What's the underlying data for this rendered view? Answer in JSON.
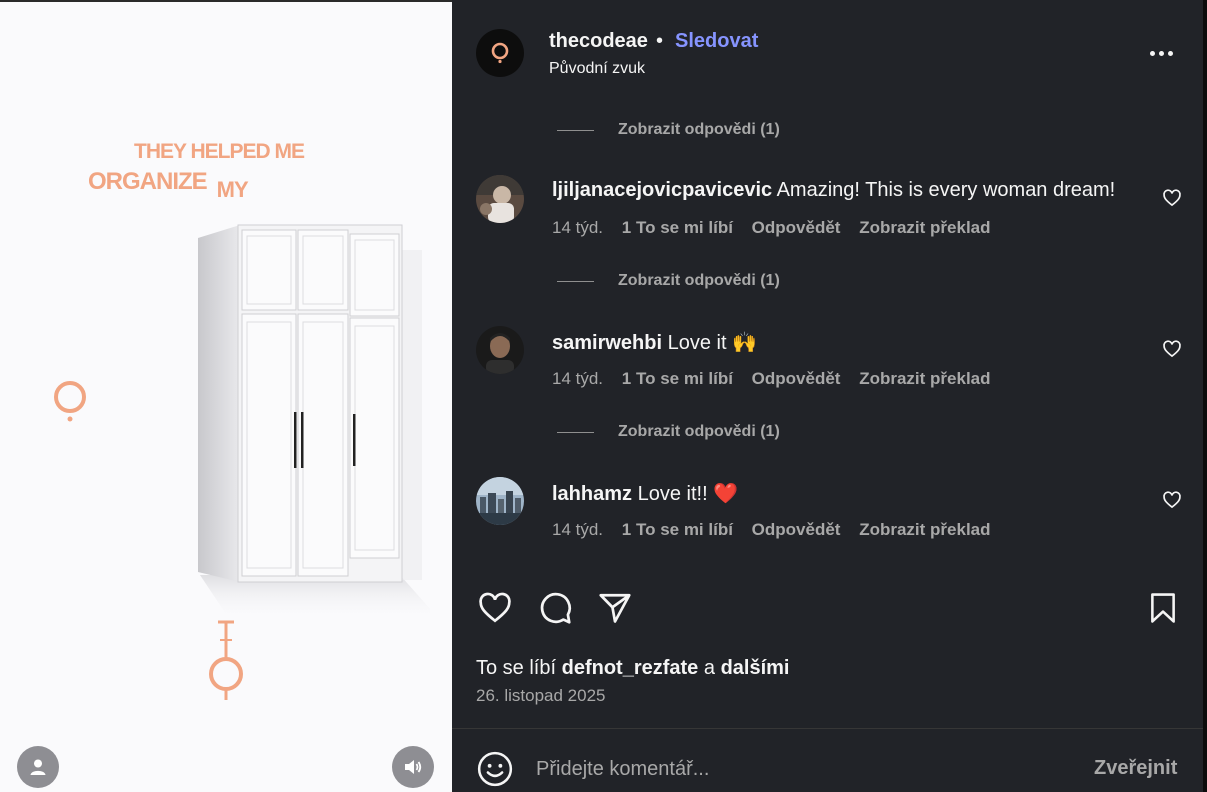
{
  "media": {
    "caption_line1": "THEY HELPED ME",
    "caption_line2": "ORGANIZE",
    "caption_line2_suffix": "MY",
    "accent_color": "#f1a582",
    "user_button_icon": "person-icon",
    "sound_button_icon": "speaker-icon"
  },
  "header": {
    "username": "thecodeae",
    "separator": "•",
    "follow_label": "Sledovat",
    "audio_label": "Původní zvuk",
    "more_icon": "more-horizontal-icon"
  },
  "comments": [
    {
      "username": "ljiljanacejovicpavicevic",
      "text": "Amazing! This is every woman dream!",
      "age": "14 týd.",
      "likes": "1 To se mi líbí",
      "reply": "Odpovědět",
      "translate": "Zobrazit překlad",
      "replies_label": "Zobrazit odpovědi (1)"
    },
    {
      "username": "samirwehbi",
      "text": "Love it 🙌",
      "age": "14 týd.",
      "likes": "1 To se mi líbí",
      "reply": "Odpovědět",
      "translate": "Zobrazit překlad",
      "replies_label": "Zobrazit odpovědi (1)"
    },
    {
      "username": "lahhamz",
      "text": "Love it!! ❤️",
      "age": "14 týd.",
      "likes": "1 To se mi líbí",
      "reply": "Odpovědět",
      "translate": "Zobrazit překlad",
      "replies_label": ""
    }
  ],
  "top_replies_label": "Zobrazit odpovědi (1)",
  "footer": {
    "likes_prefix": "To se líbí",
    "likes_user": "defnot_rezfate",
    "likes_conj": "a",
    "likes_others": "dalšími",
    "date": "26. listopad 2025",
    "comment_placeholder": "Přidejte komentář...",
    "post_label": "Zveřejnit"
  },
  "colors": {
    "panel_bg": "#212328",
    "link": "#8694ff",
    "muted": "#a8a8a8"
  }
}
